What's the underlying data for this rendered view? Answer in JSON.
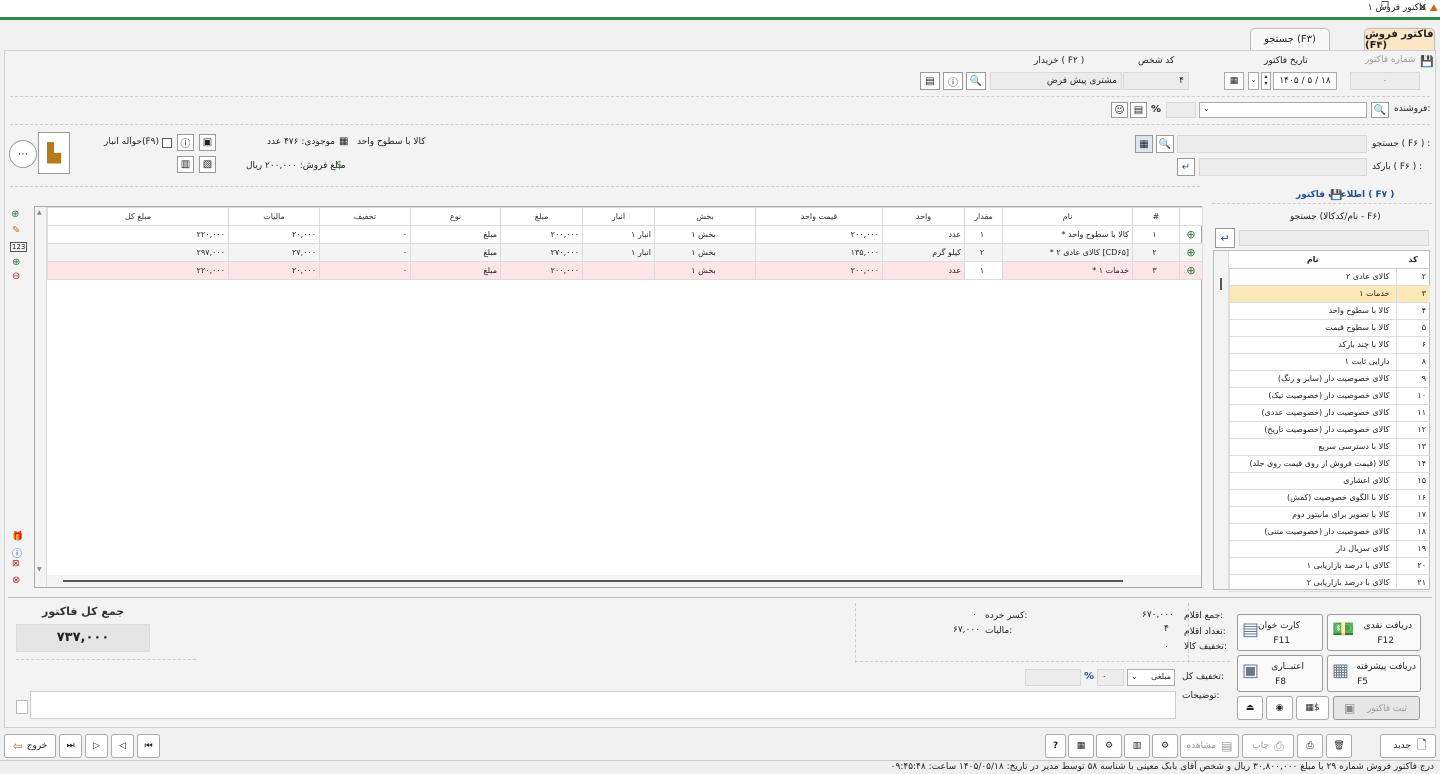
{
  "window": {
    "title": "فاکتور فروش ۱"
  },
  "tabs": [
    {
      "label": "فاکتور فروش (F۴)"
    },
    {
      "label": "جستجو (F۳)"
    }
  ],
  "header": {
    "invoice_no_label": "شماره فاکتور",
    "invoice_no_value": "۰",
    "invoice_date_label": "تاریخ فاکتور",
    "invoice_date_value": "۱۴۰۵ / ۵ / ۱۸",
    "person_code_label": "کد شخص",
    "person_code_value": "۴",
    "buyer_label": "خریدار ( F۲ )",
    "buyer_value": "مشتری پیش فرض",
    "seller_label": "فروشنده:",
    "percent_sign": "%"
  },
  "search": {
    "search_label": "جستجو ( F۶ ) :",
    "barcode_label": "بارکد ( F۶ ) :",
    "product_name": "کالا با سطوح واحد",
    "stock_text": "موجودی: ۴۷۶ عدد",
    "sale_amount_text": "مبلغ فروش: ۲۰۰,۰۰۰ ریال",
    "warehouse_transfer": "حواله انبار(F۹)"
  },
  "side_panel": {
    "title": "اطلاعات فاکتور ( F۷ )",
    "search_label": "جستجو (نام/کدکالا - F۶)",
    "col_code": "کد",
    "col_name": "نام",
    "products": [
      {
        "code": "۲",
        "name": "کالای عادی ۲"
      },
      {
        "code": "۳",
        "name": "خدمات ۱"
      },
      {
        "code": "۴",
        "name": "کالا با سطوح واحد"
      },
      {
        "code": "۵",
        "name": "کالا با سطوح قیمت"
      },
      {
        "code": "۶",
        "name": "کالا با چند بارکد"
      },
      {
        "code": "۸",
        "name": "دارایی ثابت ۱"
      },
      {
        "code": "۹",
        "name": "کالای خصوصیت دار (سایز و رنگ)"
      },
      {
        "code": "۱۰",
        "name": "کالای خصوصیت دار (خصوصیت تیک)"
      },
      {
        "code": "۱۱",
        "name": "کالای خصوصیت دار (خصوصیت عددی)"
      },
      {
        "code": "۱۲",
        "name": "کالای خصوصیت دار (خصوصیت تاریخ)"
      },
      {
        "code": "۱۳",
        "name": "کالا با دسترسی سریع"
      },
      {
        "code": "۱۴",
        "name": "کالا (قیمت فروش از روی قیمت روی جلد)"
      },
      {
        "code": "۱۵",
        "name": "کالای اعشاری"
      },
      {
        "code": "۱۶",
        "name": "کالا با الگوی خصوصیت (کفش)"
      },
      {
        "code": "۱۷",
        "name": "کالا با تصویر برای مانیتور دوم"
      },
      {
        "code": "۱۸",
        "name": "کالای خصوصیت دار (خصوصیت متنی)"
      },
      {
        "code": "۱۹",
        "name": "کالای سریال دار"
      },
      {
        "code": "۲۰",
        "name": "کالای با درصد بازاریابی ۱"
      },
      {
        "code": "۲۱",
        "name": "کالای با درصد بازاریابی ۲"
      }
    ]
  },
  "grid": {
    "columns": [
      "#",
      "نام",
      "مقدار",
      "واحد",
      "قیمت واحد",
      "بخش",
      "انبار",
      "مبلغ",
      "نوع",
      "تخفیف",
      "مالیات",
      "مبلغ کل"
    ],
    "rows": [
      {
        "n": "۱",
        "name": "* کالا با سطوح واحد",
        "qty": "۱",
        "unit": "عدد",
        "price": "۲۰۰,۰۰۰",
        "section": "بخش ۱",
        "store": "انبار ۱",
        "amount": "۲۰۰,۰۰۰",
        "type": "مبلغ",
        "discount": "۰",
        "tax": "۲۰,۰۰۰",
        "total": "۲۲۰,۰۰۰"
      },
      {
        "n": "۲",
        "name": "* کالای عادی ۲ [CD۶۵]",
        "qty": "۲",
        "unit": "کیلو گرم",
        "price": "۱۳۵,۰۰۰",
        "section": "بخش ۱",
        "store": "انبار ۱",
        "amount": "۲۷۰,۰۰۰",
        "type": "مبلغ",
        "discount": "۰",
        "tax": "۲۷,۰۰۰",
        "total": "۲۹۷,۰۰۰"
      },
      {
        "n": "۳",
        "name": "* خدمات ۱",
        "qty": "۱",
        "unit": "عدد",
        "price": "۲۰۰,۰۰۰",
        "section": "بخش ۱",
        "store": "",
        "amount": "۲۰۰,۰۰۰",
        "type": "مبلغ",
        "discount": "۰",
        "tax": "۲۰,۰۰۰",
        "total": "۲۲۰,۰۰۰"
      }
    ]
  },
  "summary": {
    "items_sum_label": "جمع اقلام:",
    "items_sum_value": "۶۷۰,۰۰۰",
    "items_count_label": "تعداد اقلام:",
    "items_count_value": "۴",
    "goods_discount_label": "تخفیف کالا:",
    "goods_discount_value": "۰",
    "rounding_label": "کسر خرده:",
    "rounding_value": "۰",
    "tax_label": "مالیات:",
    "tax_value": "۶۷,۰۰۰",
    "total_discount_label": "تخفیف کل:",
    "discount_type": "مبلغی",
    "discount_value": "۰",
    "notes_label": "توضیحات:",
    "grand_total_label": "جمع کل فاکتور",
    "grand_total_value": "۷۳۷,۰۰۰"
  },
  "payments": {
    "cash": "دریافت نقدی",
    "cash_key": "F12",
    "card": "کارت خوان",
    "card_key": "F11",
    "advanced": "دریافت پیشرفته",
    "advanced_key": "F5",
    "credit": "اعتبــاری",
    "credit_key": "F8",
    "submit": "ثبت فاکتور"
  },
  "toolbar": {
    "new": "جدید",
    "print": "چاپ",
    "view": "مشاهده",
    "exit": "خروج"
  },
  "status_bar": {
    "text": "درج فاکتور فروش شماره ۲۹ با مبلغ ۳۰,۸۰۰,۰۰۰ ریال و شخص آقای بابک معینی با شناسه ۵۸ توسط مدیر در تاریخ: ۱۴۰۵/۰۵/۱۸ ساعت: ۰۹:۴۵:۴۸"
  },
  "colors": {
    "accent": "#2f8a4a",
    "selected_row": "#fde9b8",
    "highlight_row": "#fde4e8",
    "tab_active": "#fbe6c6"
  }
}
